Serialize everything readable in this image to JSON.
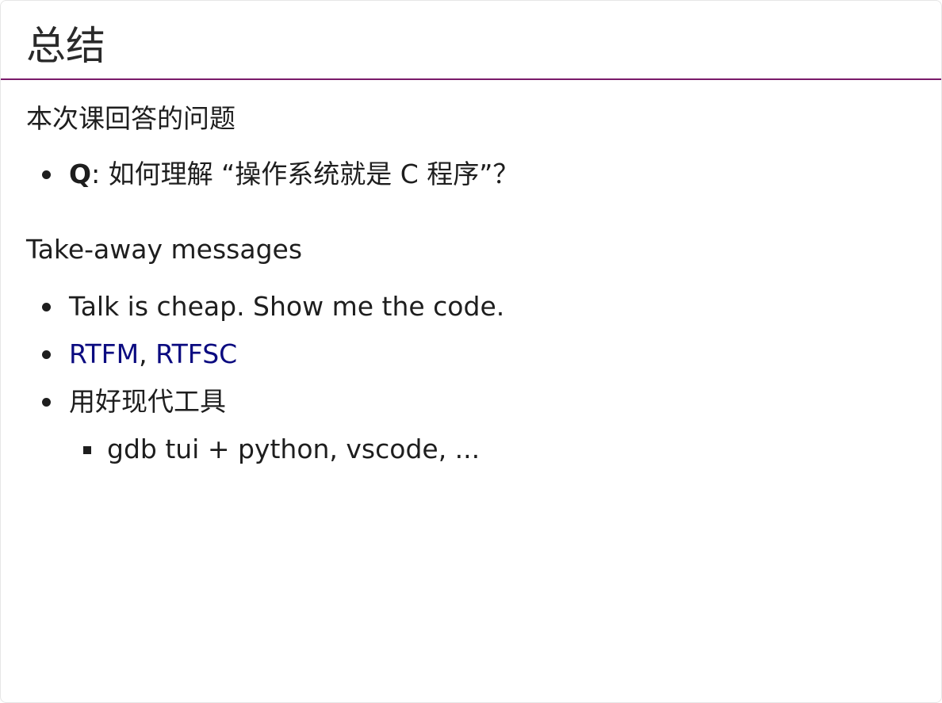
{
  "slide": {
    "title": "总结",
    "accent_color": "#7a1a6a",
    "link_color": "#0b0b80"
  },
  "questions": {
    "heading": "本次课回答的问题",
    "items": [
      {
        "label": "Q",
        "text": ": 如何理解 “操作系统就是 C 程序”？"
      }
    ]
  },
  "takeaways": {
    "heading": "Take-away messages",
    "item_1": "Talk is cheap. Show me the code.",
    "links": [
      "RTFM",
      "RTFSC"
    ],
    "link_separator": ", ",
    "item_3": "用好现代工具",
    "sub_item": "gdb tui + python, vscode, ..."
  }
}
